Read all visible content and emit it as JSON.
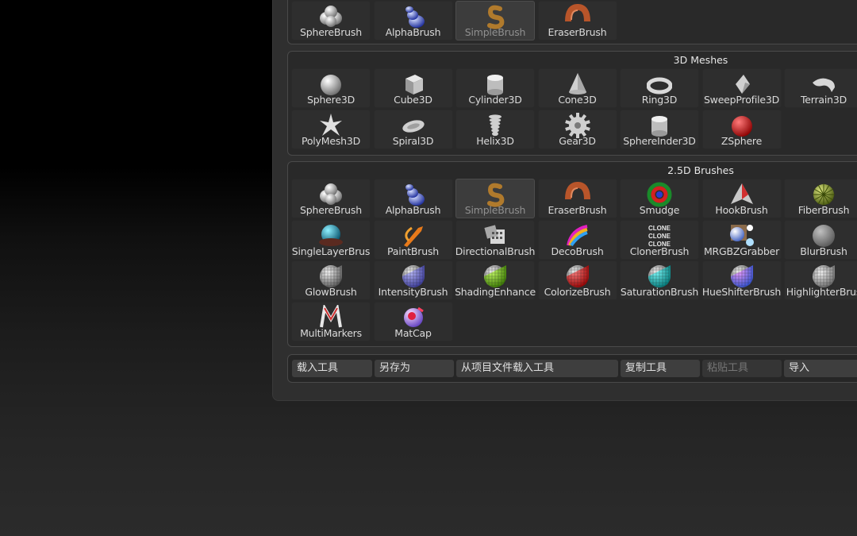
{
  "top_row": [
    {
      "label": "SphereBrush",
      "icon": "sphere-brush-icon"
    },
    {
      "label": "AlphaBrush",
      "icon": "alpha-brush-icon"
    },
    {
      "label": "SimpleBrush",
      "icon": "simple-brush-icon",
      "selected": true
    },
    {
      "label": "EraserBrush",
      "icon": "eraser-brush-icon"
    }
  ],
  "meshes": {
    "title": "3D Meshes",
    "items": [
      {
        "label": "Sphere3D",
        "icon": "sphere3d-icon"
      },
      {
        "label": "Cube3D",
        "icon": "cube3d-icon"
      },
      {
        "label": "Cylinder3D",
        "icon": "cylinder3d-icon"
      },
      {
        "label": "Cone3D",
        "icon": "cone3d-icon"
      },
      {
        "label": "Ring3D",
        "icon": "ring3d-icon"
      },
      {
        "label": "SweepProfile3D",
        "icon": "sweep-profile3d-icon"
      },
      {
        "label": "Terrain3D",
        "icon": "terrain3d-icon"
      },
      {
        "label": "PolyMesh3D",
        "icon": "polymesh3d-icon"
      },
      {
        "label": "Spiral3D",
        "icon": "spiral3d-icon"
      },
      {
        "label": "Helix3D",
        "icon": "helix3d-icon"
      },
      {
        "label": "Gear3D",
        "icon": "gear3d-icon"
      },
      {
        "label": "SphereInder3D",
        "icon": "sphereinder3d-icon"
      },
      {
        "label": "ZSphere",
        "icon": "zsphere-icon"
      }
    ]
  },
  "brushes": {
    "title": "2.5D Brushes",
    "items": [
      {
        "label": "SphereBrush",
        "icon": "sphere-brush-icon"
      },
      {
        "label": "AlphaBrush",
        "icon": "alpha-brush-icon"
      },
      {
        "label": "SimpleBrush",
        "icon": "simple-brush-icon",
        "selected": true
      },
      {
        "label": "EraserBrush",
        "icon": "eraser-brush-icon"
      },
      {
        "label": "Smudge",
        "icon": "smudge-icon"
      },
      {
        "label": "HookBrush",
        "icon": "hook-brush-icon"
      },
      {
        "label": "FiberBrush",
        "icon": "fiber-brush-icon"
      },
      {
        "label": "SingleLayerBrus",
        "icon": "single-layer-brush-icon"
      },
      {
        "label": "PaintBrush",
        "icon": "paint-brush-icon"
      },
      {
        "label": "DirectionalBrush",
        "icon": "directional-brush-icon"
      },
      {
        "label": "DecoBrush",
        "icon": "deco-brush-icon"
      },
      {
        "label": "ClonerBrush",
        "icon": "cloner-brush-icon"
      },
      {
        "label": "MRGBZGrabber",
        "icon": "mrgbz-grabber-icon"
      },
      {
        "label": "BlurBrush",
        "icon": "blur-brush-icon"
      },
      {
        "label": "GlowBrush",
        "icon": "glow-brush-icon"
      },
      {
        "label": "IntensityBrush",
        "icon": "intensity-brush-icon"
      },
      {
        "label": "ShadingEnhance",
        "icon": "shading-enhance-icon"
      },
      {
        "label": "ColorizeBrush",
        "icon": "colorize-brush-icon"
      },
      {
        "label": "SaturationBrush",
        "icon": "saturation-brush-icon"
      },
      {
        "label": "HueShifterBrush",
        "icon": "hue-shifter-brush-icon"
      },
      {
        "label": "HighlighterBrus",
        "icon": "highlighter-brush-icon"
      },
      {
        "label": "MultiMarkers",
        "icon": "multi-markers-icon"
      },
      {
        "label": "MatCap",
        "icon": "matcap-icon"
      }
    ]
  },
  "buttons": [
    {
      "label": "载入工具",
      "name": "load-tool-button"
    },
    {
      "label": "另存为",
      "name": "save-as-button"
    },
    {
      "label": "从项目文件载入工具",
      "name": "load-tool-from-project-button"
    },
    {
      "label": "复制工具",
      "name": "copy-tool-button"
    },
    {
      "label": "粘贴工具",
      "name": "paste-tool-button",
      "disabled": true
    },
    {
      "label": "导入",
      "name": "import-button"
    }
  ]
}
